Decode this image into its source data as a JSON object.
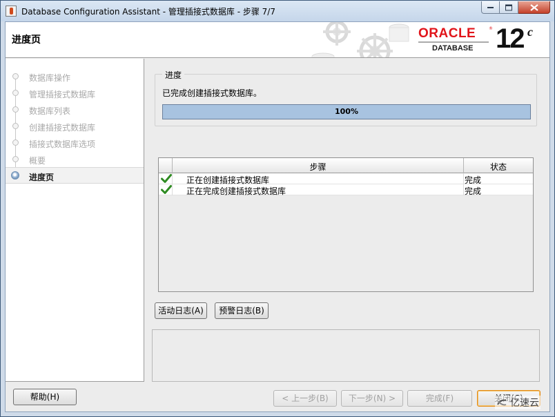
{
  "window": {
    "title": "Database Configuration Assistant - 管理插接式数据库 - 步骤 7/7"
  },
  "header": {
    "page_title": "进度页",
    "brand": "ORACLE",
    "brand_sub": "DATABASE",
    "version": "12",
    "version_sup": "c"
  },
  "nav": {
    "items": [
      {
        "label": "数据库操作",
        "state": "done"
      },
      {
        "label": "管理插接式数据库",
        "state": "done"
      },
      {
        "label": "数据库列表",
        "state": "done"
      },
      {
        "label": "创建插接式数据库",
        "state": "done"
      },
      {
        "label": "插接式数据库选项",
        "state": "done"
      },
      {
        "label": "概要",
        "state": "done"
      },
      {
        "label": "进度页",
        "state": "active"
      }
    ]
  },
  "progress": {
    "group_label": "进度",
    "status": "已完成创建插接式数据库。",
    "percent_text": "100%",
    "fraction": 1.0
  },
  "steps_table": {
    "headers": {
      "step": "步骤",
      "status": "状态"
    },
    "rows": [
      {
        "icon": "check-icon",
        "step": "正在创建插接式数据库",
        "status": "完成"
      },
      {
        "icon": "check-icon",
        "step": "正在完成创建插接式数据库",
        "status": "完成"
      }
    ]
  },
  "log_buttons": {
    "activity": "活动日志(A)",
    "alert": "预警日志(B)"
  },
  "footer": {
    "help": "帮助(H)",
    "back": "< 上一步(B)",
    "next": "下一步(N) >",
    "finish": "完成(F)",
    "close": "关闭(C)"
  },
  "watermark": "亿速云",
  "colors": {
    "oracle_red": "#e1141a",
    "progress_fill": "#a8c3e0",
    "check_green": "#2e8b22"
  }
}
